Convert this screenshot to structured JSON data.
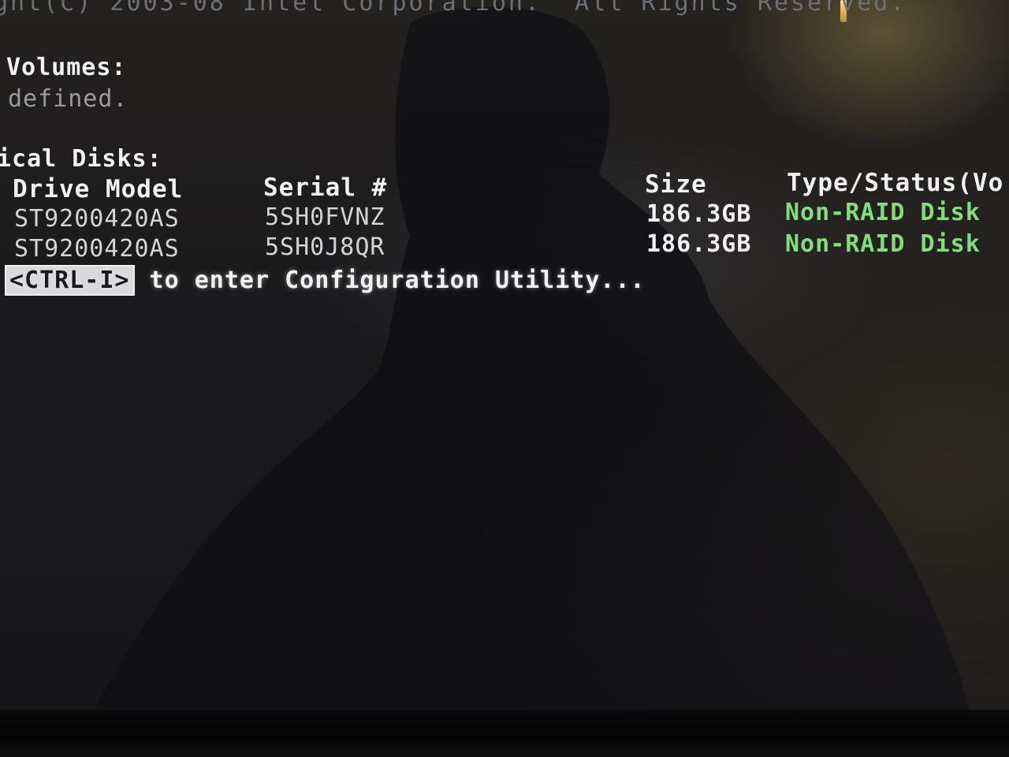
{
  "header": {
    "copyright": "ght(C) 2003-08 Intel Corporation.  All Rights Reserved."
  },
  "volumes": {
    "title": "Volumes:",
    "status": "defined."
  },
  "disks": {
    "title": "ical Disks:",
    "columns": {
      "drive_model": "Drive Model",
      "serial": "Serial #",
      "size": "Size",
      "type_status": "Type/Status(Vo"
    },
    "rows": [
      {
        "drive_model": "ST9200420AS",
        "serial": "5SH0FVNZ",
        "size": "186.3GB",
        "type_status": "Non-RAID Disk"
      },
      {
        "drive_model": "ST9200420AS",
        "serial": "5SH0J8QR",
        "size": "186.3GB",
        "type_status": "Non-RAID Disk"
      }
    ]
  },
  "prompt": {
    "key": "<CTRL-I>",
    "text": " to enter Configuration Utility..."
  },
  "colors": {
    "status_green": "#7fe07a",
    "text_white": "#f2f2f4",
    "background": "#17161a"
  }
}
